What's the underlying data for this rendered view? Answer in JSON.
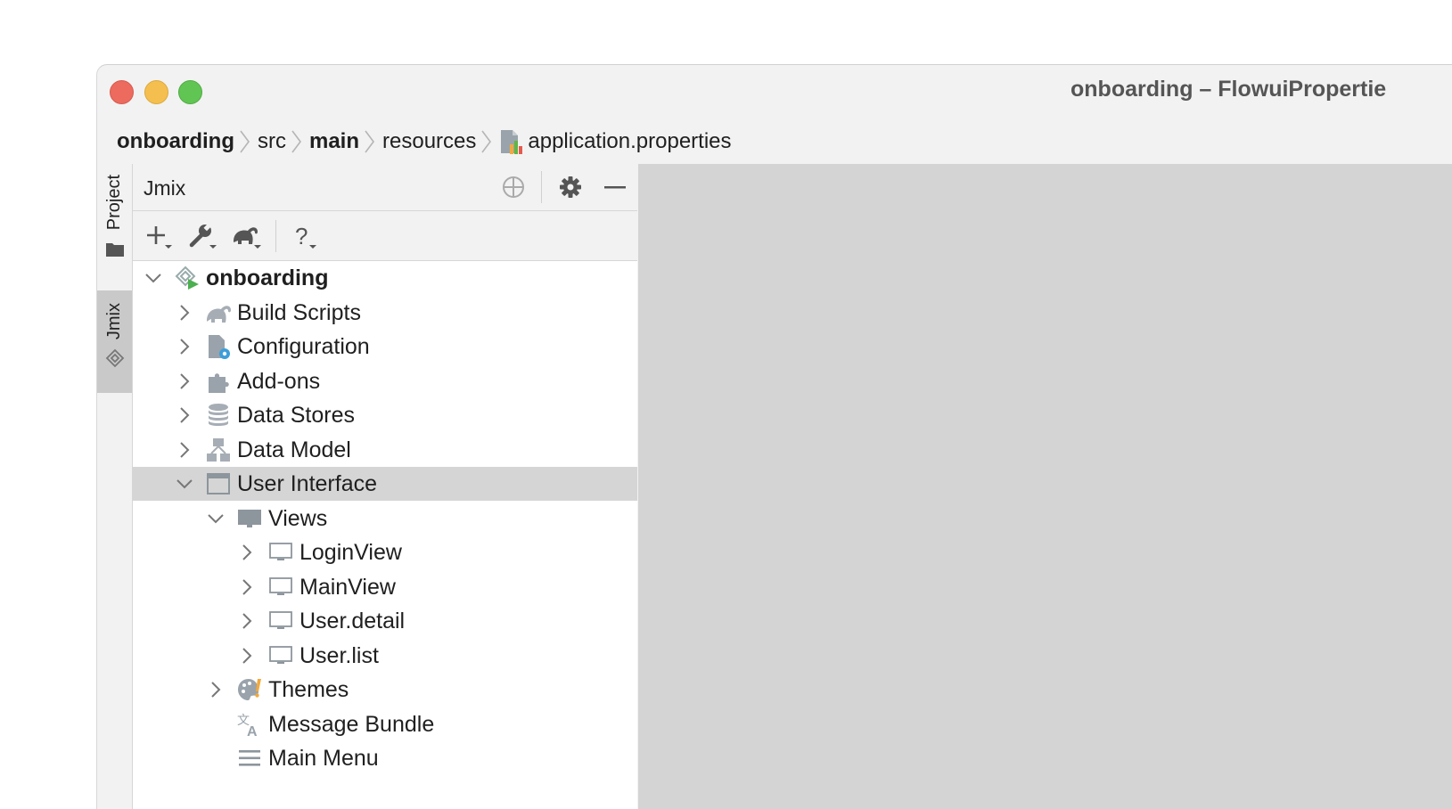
{
  "window": {
    "title": "onboarding – FlowuiPropertie",
    "breadcrumb": [
      {
        "label": "onboarding",
        "bold": true
      },
      {
        "label": "src",
        "bold": false
      },
      {
        "label": "main",
        "bold": true
      },
      {
        "label": "resources",
        "bold": false
      },
      {
        "label": "application.properties",
        "bold": false,
        "icon": "properties-file-icon"
      }
    ]
  },
  "side_tabs": [
    {
      "label": "Project",
      "icon": "folder-icon",
      "active": false
    },
    {
      "label": "Jmix",
      "icon": "jmix-icon",
      "active": true
    }
  ],
  "panel": {
    "title": "Jmix",
    "header_icons": [
      "locate-icon",
      "gear-icon",
      "minimize-icon"
    ],
    "toolbar": [
      "add-icon",
      "wrench-icon",
      "gradle-elephant-icon",
      "help-icon"
    ]
  },
  "tree": [
    {
      "label": "onboarding",
      "icon": "jmix-project-icon",
      "expanded": true,
      "level": 0
    },
    {
      "label": "Build Scripts",
      "icon": "gradle-elephant-icon",
      "expanded": false,
      "level": 1
    },
    {
      "label": "Configuration",
      "icon": "configuration-icon",
      "expanded": false,
      "level": 1
    },
    {
      "label": "Add-ons",
      "icon": "puzzle-icon",
      "expanded": false,
      "level": 1
    },
    {
      "label": "Data Stores",
      "icon": "database-icon",
      "expanded": false,
      "level": 1
    },
    {
      "label": "Data Model",
      "icon": "data-model-icon",
      "expanded": false,
      "level": 1
    },
    {
      "label": "User Interface",
      "icon": "window-icon",
      "expanded": true,
      "level": 1,
      "selected": true
    },
    {
      "label": "Views",
      "icon": "monitor-filled-icon",
      "expanded": true,
      "level": 2
    },
    {
      "label": "LoginView",
      "icon": "monitor-icon",
      "expanded": false,
      "level": 3
    },
    {
      "label": "MainView",
      "icon": "monitor-icon",
      "expanded": false,
      "level": 3
    },
    {
      "label": "User.detail",
      "icon": "monitor-icon",
      "expanded": false,
      "level": 3
    },
    {
      "label": "User.list",
      "icon": "monitor-icon",
      "expanded": false,
      "level": 3
    },
    {
      "label": "Themes",
      "icon": "palette-icon",
      "expanded": false,
      "level": 2
    },
    {
      "label": "Message Bundle",
      "icon": "translate-icon",
      "leaf": true,
      "level": 2
    },
    {
      "label": "Main Menu",
      "icon": "menu-icon",
      "leaf": true,
      "level": 2
    }
  ],
  "colors": {
    "close": "#ed6a5e",
    "minimize": "#f5bf4f",
    "maximize": "#61c554",
    "selection": "#d5d5d5",
    "editor_bg": "#d4d4d4"
  }
}
